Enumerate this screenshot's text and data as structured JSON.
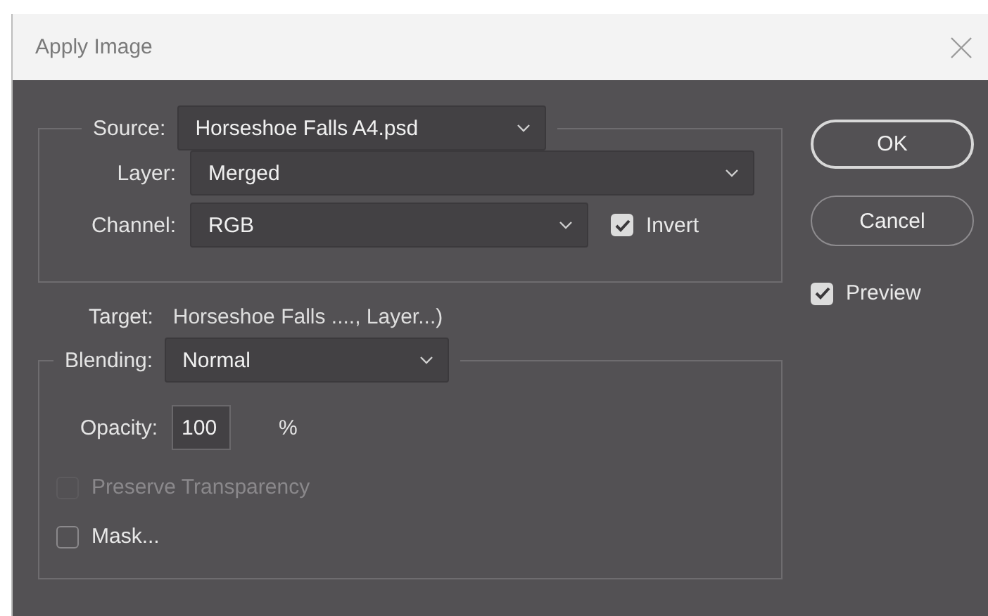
{
  "window": {
    "title": "Apply Image"
  },
  "source": {
    "label": "Source:",
    "value": "Horseshoe Falls A4.psd"
  },
  "layer": {
    "label": "Layer:",
    "value": "Merged"
  },
  "channel": {
    "label": "Channel:",
    "value": "RGB"
  },
  "invert": {
    "label": "Invert",
    "checked": true
  },
  "target": {
    "label": "Target:",
    "value": "Horseshoe Falls ...., Layer...)"
  },
  "blending": {
    "label": "Blending:",
    "value": "Normal"
  },
  "opacity": {
    "label": "Opacity:",
    "value": "100",
    "unit": "%"
  },
  "preserve_transparency": {
    "label": "Preserve Transparency",
    "checked": false,
    "disabled": true
  },
  "mask": {
    "label": "Mask...",
    "checked": false,
    "disabled": false
  },
  "buttons": [
    {
      "label": "OK",
      "default": true
    },
    {
      "label": "Cancel",
      "default": false
    }
  ],
  "preview": {
    "label": "Preview",
    "checked": true
  }
}
